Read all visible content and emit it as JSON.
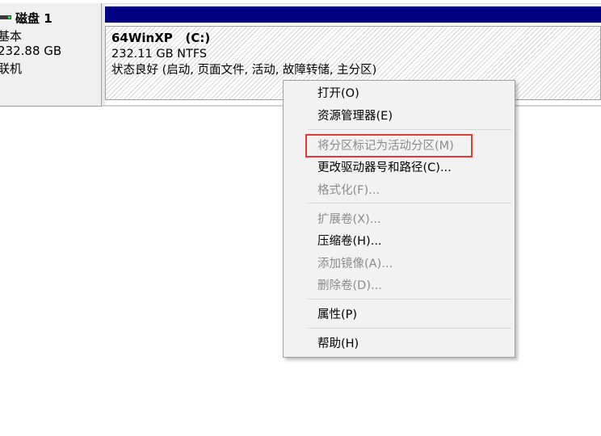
{
  "disk": {
    "title": "磁盘 1",
    "type": "基本",
    "size": "232.88 GB",
    "status": "联机"
  },
  "partition": {
    "name": "64WinXP   (C:)",
    "size_fs": "232.11 GB NTFS",
    "status": "状态良好 (启动, 页面文件, 活动, 故障转储, 主分区)"
  },
  "context_menu": {
    "items": [
      {
        "label": "打开(O)",
        "enabled": true
      },
      {
        "label": "资源管理器(E)",
        "enabled": true
      },
      {
        "label": "将分区标记为活动分区(M)",
        "enabled": false
      },
      {
        "label": "更改驱动器号和路径(C)...",
        "enabled": true
      },
      {
        "label": "格式化(F)...",
        "enabled": false
      },
      {
        "label": "扩展卷(X)...",
        "enabled": false
      },
      {
        "label": "压缩卷(H)...",
        "enabled": true
      },
      {
        "label": "添加镜像(A)...",
        "enabled": false
      },
      {
        "label": "删除卷(D)...",
        "enabled": false
      },
      {
        "label": "属性(P)",
        "enabled": true
      },
      {
        "label": "帮助(H)",
        "enabled": true
      }
    ]
  },
  "colors": {
    "partition_header": "#000080",
    "highlight": "#e53935",
    "disabled_text": "#8c8c8c",
    "menu_bg": "#f2f2f2"
  },
  "icons": {
    "disk": "hard-disk-icon"
  }
}
